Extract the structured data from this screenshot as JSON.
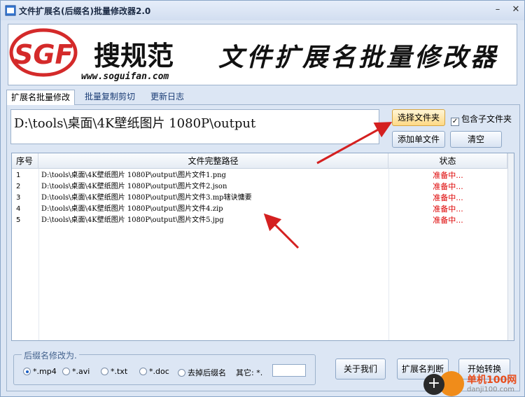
{
  "window": {
    "title": "文件扩展名(后缀名)批量修改器2.0",
    "min": "–",
    "close": "✕"
  },
  "banner": {
    "brand": "搜规范",
    "logo_text": "SGF",
    "url": "www.soguifan.com",
    "slogan": "文件扩展名批量修改器"
  },
  "tabs": [
    {
      "label": "扩展名批量修改",
      "active": true
    },
    {
      "label": "批量复制剪切",
      "active": false
    },
    {
      "label": "更新日志",
      "active": false
    }
  ],
  "path_value": "D:\\tools\\桌面\\4K壁纸图片 1080P\\output",
  "buttons": {
    "select_folder": "选择文件夹",
    "add_file": "添加单文件",
    "clear": "清空",
    "about": "关于我们",
    "check_ext": "扩展名判断",
    "start": "开始转换"
  },
  "include_subfolders": {
    "label": "包含子文件夹",
    "checked": true
  },
  "table": {
    "headers": [
      "序号",
      "文件完整路径",
      "状态"
    ],
    "rows": [
      {
        "num": "1",
        "path": "D:\\tools\\桌面\\4K壁纸图片 1080P\\output\\图片文件1.png",
        "status": "准备中..."
      },
      {
        "num": "2",
        "path": "D:\\tools\\桌面\\4K壁纸图片 1080P\\output\\图片文件2.json",
        "status": "准备中..."
      },
      {
        "num": "3",
        "path": "D:\\tools\\桌面\\4K壁纸图片 1080P\\output\\图片文件3.mp辖诀慵要",
        "status": "准备中..."
      },
      {
        "num": "4",
        "path": "D:\\tools\\桌面\\4K壁纸图片 1080P\\output\\图片文件4.zip",
        "status": "准备中..."
      },
      {
        "num": "5",
        "path": "D:\\tools\\桌面\\4K壁纸图片 1080P\\output\\图片文件5.jpg",
        "status": "准备中..."
      }
    ]
  },
  "ext_group": {
    "legend": "后缀名修改为.",
    "options": [
      {
        "label": "*.mp4",
        "selected": true
      },
      {
        "label": "*.avi",
        "selected": false
      },
      {
        "label": "*.txt",
        "selected": false
      },
      {
        "label": "*.doc",
        "selected": false
      },
      {
        "label": "去掉后缀名",
        "selected": false
      }
    ],
    "other_label": "其它: *."
  },
  "watermark": {
    "site": "单机100网",
    "domain": "danji100.com"
  },
  "colors": {
    "status_red": "#dd0000",
    "accent_orange": "#f08c1a",
    "logo_red": "#d42a2a"
  }
}
